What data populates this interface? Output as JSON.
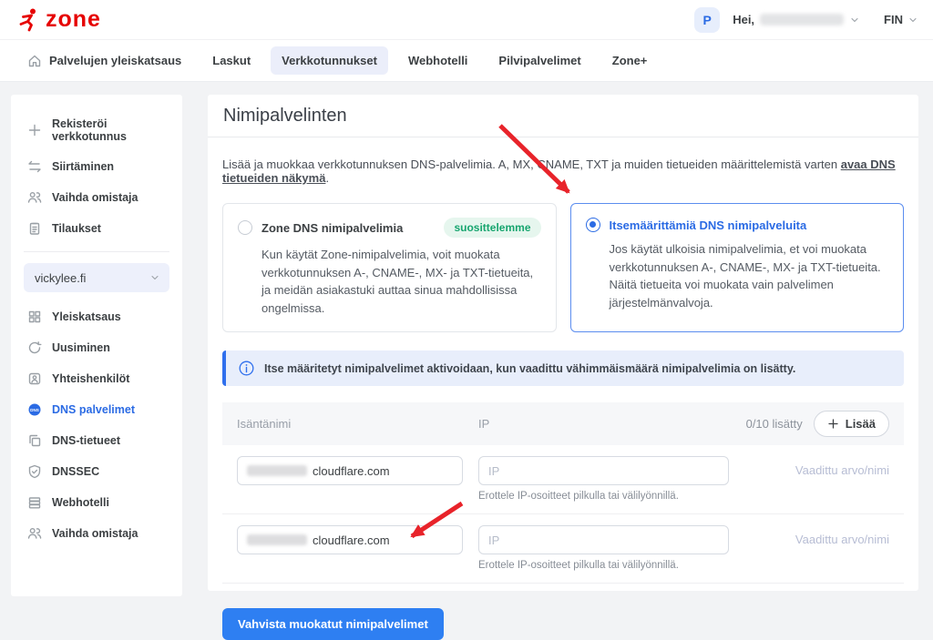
{
  "header": {
    "logo_text": "zone",
    "avatar_initial": "P",
    "greeting": "Hei,",
    "language": "FIN"
  },
  "nav": {
    "items": [
      {
        "label": "Palvelujen yleiskatsaus"
      },
      {
        "label": "Laskut"
      },
      {
        "label": "Verkkotunnukset"
      },
      {
        "label": "Webhotelli"
      },
      {
        "label": "Pilvipalvelimet"
      },
      {
        "label": "Zone+"
      }
    ]
  },
  "sidebar": {
    "top_items": [
      {
        "label": "Rekisteröi verkkotunnus"
      },
      {
        "label": "Siirtäminen"
      },
      {
        "label": "Vaihda omistaja"
      },
      {
        "label": "Tilaukset"
      }
    ],
    "domain_selector": "vickylee.fi",
    "domain_items": [
      {
        "label": "Yleiskatsaus"
      },
      {
        "label": "Uusiminen"
      },
      {
        "label": "Yhteishenkilöt"
      },
      {
        "label": "DNS palvelimet"
      },
      {
        "label": "DNS-tietueet"
      },
      {
        "label": "DNSSEC"
      },
      {
        "label": "Webhotelli"
      },
      {
        "label": "Vaihda omistaja"
      }
    ]
  },
  "main": {
    "title": "Nimipalvelinten",
    "description_prefix": "Lisää ja muokkaa verkkotunnuksen DNS-palvelimia. A, MX, CNAME, TXT ja muiden tietueiden määrittelemistä varten ",
    "description_link": "avaa DNS tietueiden näkymä",
    "description_suffix": ".",
    "options": [
      {
        "title": "Zone DNS nimipalvelimia",
        "badge": "suosittelemme",
        "body": "Kun käytät Zone-nimipalvelimia, voit muokata verkkotunnuksen A-, CNAME-, MX- ja TXT-tietueita, ja meidän asiakastuki auttaa sinua mahdollisissa ongelmissa."
      },
      {
        "title": "Itsemäärittämiä DNS nimipalveluita",
        "body": "Jos käytät ulkoisia nimipalvelimia, et voi muokata verkkotunnuksen A-, CNAME-, MX- ja TXT-tietueita. Näitä tietueita voi muokata vain palvelimen järjestelmänvalvoja."
      }
    ],
    "info_banner": "Itse määritetyt nimipalvelimet aktivoidaan, kun vaadittu vähimmäismäärä nimipalvelimia on lisätty.",
    "table": {
      "col_hostname": "Isäntänimi",
      "col_ip": "IP",
      "count_label": "0/10 lisätty",
      "add_button": "Lisää",
      "rows": [
        {
          "hostname_suffix": "cloudflare.com",
          "ip_placeholder": "IP",
          "helper": "Erottele IP-osoitteet pilkulla tai välilyönnillä.",
          "required_label": "Vaadittu arvo/nimi"
        },
        {
          "hostname_suffix": "cloudflare.com",
          "ip_placeholder": "IP",
          "helper": "Erottele IP-osoitteet pilkulla tai välilyönnillä.",
          "required_label": "Vaadittu arvo/nimi"
        }
      ]
    },
    "submit_button": "Vahvista muokatut nimipalvelimet"
  },
  "colors": {
    "brand_red": "#e60000",
    "accent_blue": "#2b6be4",
    "button_blue": "#2e7ff2",
    "badge_green": "#17a56f",
    "arrow_red": "#e8232a",
    "banner_blue_bg": "#e8eefb"
  }
}
